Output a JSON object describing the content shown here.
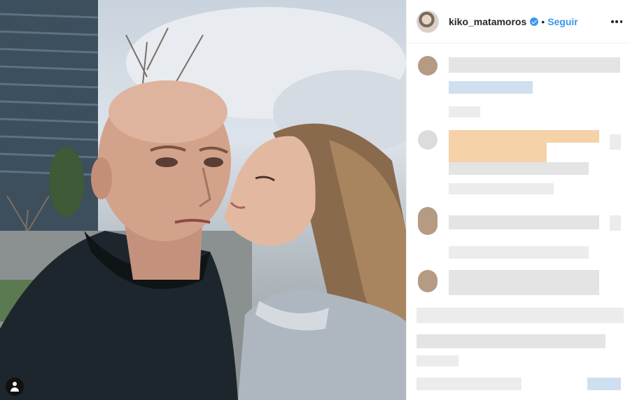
{
  "post": {
    "username": "kiko_matamoros",
    "separator": "•",
    "follow_label": "Seguir"
  },
  "icons": {
    "verified": "verified-badge-icon",
    "more": "more-options-icon",
    "user_tag": "user-tag-icon"
  },
  "colors": {
    "accent": "#3897f0",
    "text": "#262626",
    "border": "#efefef"
  }
}
